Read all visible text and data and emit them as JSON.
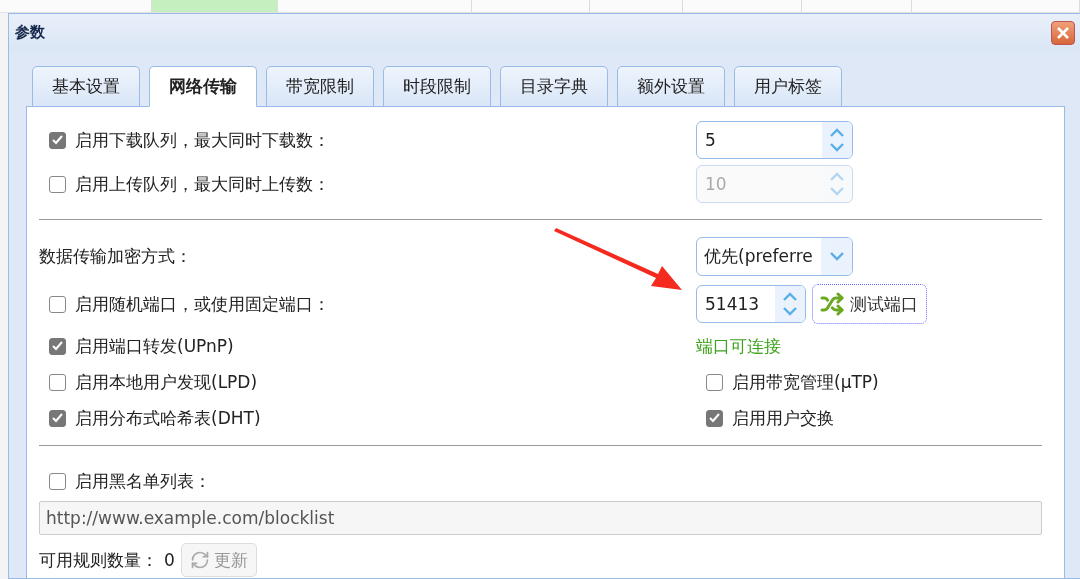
{
  "window": {
    "title": "参数"
  },
  "tabs": [
    {
      "label": "基本设置",
      "selected": false
    },
    {
      "label": "网络传输",
      "selected": true
    },
    {
      "label": "带宽限制",
      "selected": false
    },
    {
      "label": "时段限制",
      "selected": false
    },
    {
      "label": "目录字典",
      "selected": false
    },
    {
      "label": "额外设置",
      "selected": false
    },
    {
      "label": "用户标签",
      "selected": false
    }
  ],
  "queues": [
    {
      "label": "启用下载队列，最大同时下载数：",
      "checked": true,
      "value": "5",
      "disabled": false
    },
    {
      "label": "启用上传队列，最大同时上传数：",
      "checked": false,
      "value": "10",
      "disabled": true
    }
  ],
  "encryption": {
    "label": "数据传输加密方式：",
    "value": "优先(preferre"
  },
  "port": {
    "label": "启用随机端口，或使用固定端口：",
    "checked": false,
    "value": "51413",
    "test_button": "测试端口",
    "status": "端口可连接"
  },
  "options_left": [
    {
      "label": "启用端口转发(UPnP)",
      "checked": true
    },
    {
      "label": "启用本地用户发现(LPD)",
      "checked": false
    },
    {
      "label": "启用分布式哈希表(DHT)",
      "checked": true
    }
  ],
  "options_right": [
    {
      "label": "启用带宽管理(µTP)",
      "checked": false
    },
    {
      "label": "启用用户交换",
      "checked": true
    }
  ],
  "blocklist": {
    "label": "启用黑名单列表：",
    "checked": false,
    "url": "http://www.example.com/blocklist",
    "url_disabled": true,
    "rule_count_label": "可用规则数量：",
    "rule_count": "0",
    "update_button": "更新",
    "update_disabled": true
  }
}
